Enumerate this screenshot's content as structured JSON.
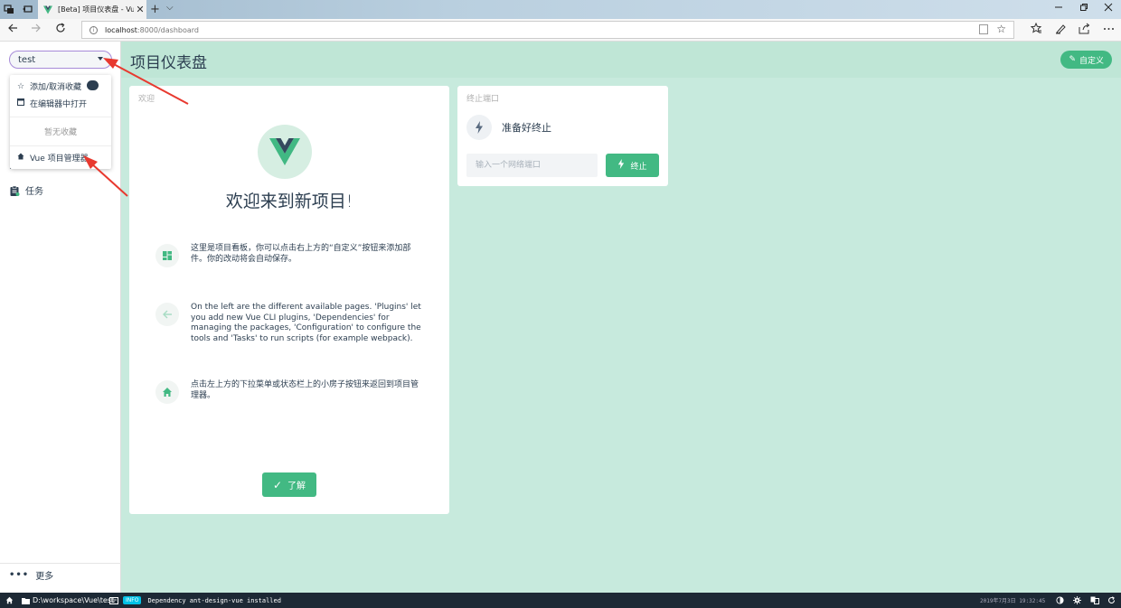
{
  "browser": {
    "tab_title": "[Beta] 项目仪表盘 - Vue",
    "tab_close": "✕",
    "new_tab": "+",
    "tab_dropdown": "⌵",
    "url_host": "localhost",
    "url_path": ":8000/dashboard"
  },
  "sidebar": {
    "project_name": "test",
    "items": [
      {
        "label": "任务"
      }
    ],
    "more_label": "更多"
  },
  "dropdown": {
    "favorite_label": "添加/取消收藏",
    "open_editor_label": "在编辑器中打开",
    "empty_label": "暂无收藏",
    "manager_label": "Vue 项目管理器"
  },
  "header": {
    "title": "项目仪表盘",
    "customize_label": "自定义"
  },
  "welcome": {
    "card_title": "欢迎",
    "heading": "欢迎来到新项目!",
    "tips": [
      {
        "icon": "dashboard-icon",
        "text": "这里是项目看板，你可以点击右上方的“自定义”按钮来添加部件。你的改动将会自动保存。"
      },
      {
        "icon": "arrow-left-icon",
        "text": "On the left are the different available pages. 'Plugins' let you add new Vue CLI plugins, 'Dependencies' for managing the packages, 'Configuration' to configure the tools and 'Tasks' to run scripts (for example webpack)."
      },
      {
        "icon": "home-icon",
        "text": "点击左上方的下拉菜单或状态栏上的小房子按钮来返回到项目管理器。"
      }
    ],
    "ok_label": "了解"
  },
  "kill_port": {
    "card_title": "终止端口",
    "status_text": "准备好终止",
    "input_placeholder": "输入一个网络端口",
    "button_label": "终止"
  },
  "statusbar": {
    "path": "D:\\workspace\\Vue\\test",
    "log_level": "INFO",
    "log_message": "Dependency ant-design-vue installed",
    "timestamp": "2019年7月3日 19:32:45"
  },
  "colors": {
    "accent": "#42b983",
    "main_bg": "#c7eadd",
    "header_bg": "#bfe6d6",
    "statusbar_bg": "#1d2935",
    "info_badge": "#03c2e6",
    "arrow": "#e8392f"
  }
}
